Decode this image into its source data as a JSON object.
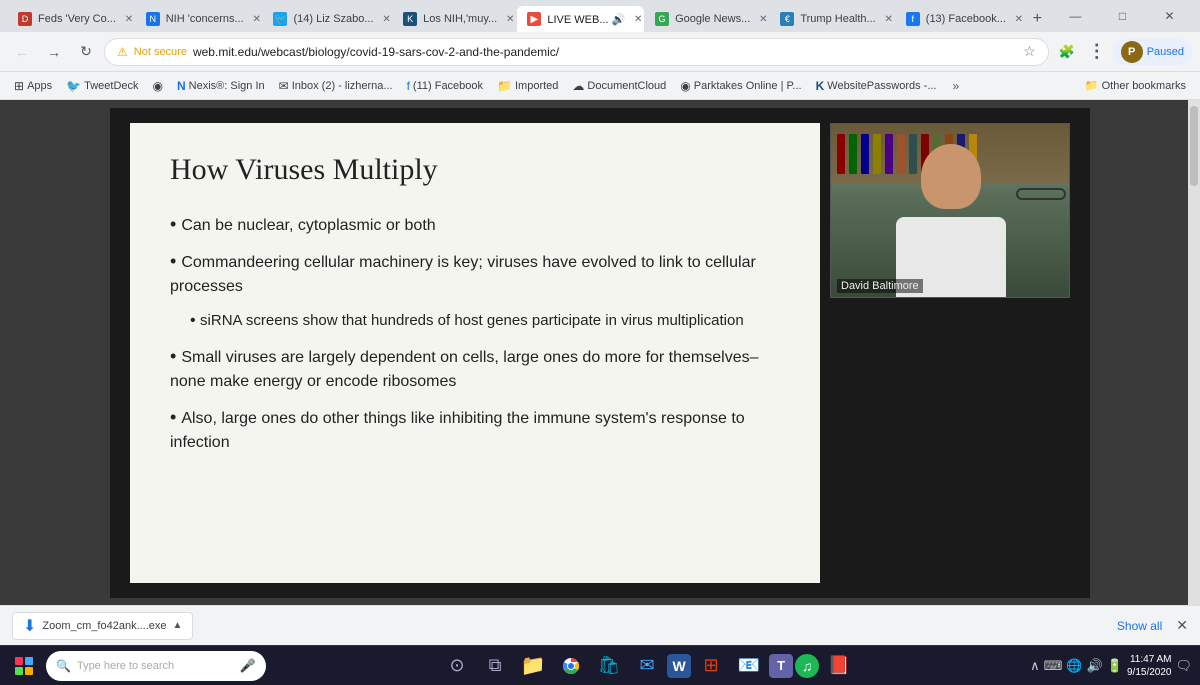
{
  "titlebar": {
    "tabs": [
      {
        "id": "tab1",
        "favicon": "DB",
        "favicon_bg": "#c0392b",
        "label": "Feds 'Very Co...",
        "active": false
      },
      {
        "id": "tab2",
        "favicon": "N",
        "favicon_bg": "#1a73e8",
        "label": "NIH 'concerns...",
        "active": false
      },
      {
        "id": "tab3",
        "favicon": "🐦",
        "favicon_bg": "#1da1f2",
        "label": "(14) Liz Szabo...",
        "active": false
      },
      {
        "id": "tab4",
        "favicon": "K",
        "favicon_bg": "#1a5276",
        "label": "Los NIH,'muy...",
        "active": false
      },
      {
        "id": "tab5",
        "favicon": "▶",
        "favicon_bg": "#e74c3c",
        "label": "LIVE WEB... 🔊",
        "active": true
      },
      {
        "id": "tab6",
        "favicon": "G",
        "favicon_bg": "#34a853",
        "label": "Google News...",
        "active": false
      },
      {
        "id": "tab7",
        "favicon": "€",
        "favicon_bg": "#2980b9",
        "label": "Trump Health...",
        "active": false
      },
      {
        "id": "tab8",
        "favicon": "f",
        "favicon_bg": "#1877f2",
        "label": "(13) Facebook...",
        "active": false
      }
    ],
    "window_controls": [
      "—",
      "□",
      "✕"
    ]
  },
  "navbar": {
    "url": "web.mit.edu/webcast/biology/covid-19-sars-cov-2-and-the-pandemic/",
    "url_display": "web.mit.edu/webcast/biology/covid-19-sars-cov-2-and-the-pandemic/",
    "profile_label": "Paused",
    "profile_initial": "P"
  },
  "bookmarks": {
    "items": [
      {
        "icon": "⊞",
        "label": "Apps"
      },
      {
        "icon": "🐦",
        "label": "TweetDeck"
      },
      {
        "icon": "◉",
        "label": ""
      },
      {
        "icon": "N",
        "label": "Nexis®: Sign In"
      },
      {
        "icon": "✉",
        "label": "Inbox (2) - lizherna..."
      },
      {
        "icon": "f",
        "label": "(11) Facebook"
      },
      {
        "icon": "📁",
        "label": "Imported"
      },
      {
        "icon": "☁",
        "label": "DocumentCloud"
      },
      {
        "icon": "◉",
        "label": "Parktakes Online | P..."
      },
      {
        "icon": "K",
        "label": "WebsitePasswords -..."
      }
    ],
    "more_label": "»",
    "other_label": "Other bookmarks"
  },
  "slide": {
    "title": "How Viruses Multiply",
    "bullets": [
      {
        "text": "Can be nuclear, cytoplasmic or both",
        "sub": false
      },
      {
        "text": "Commandeering cellular machinery is key; viruses have evolved to link to cellular processes",
        "sub": false
      },
      {
        "text": "siRNA screens show that hundreds of host genes participate in virus multiplication",
        "sub": true
      },
      {
        "text": "Small viruses are largely dependent on cells, large ones do more for themselves– none make energy or encode ribosomes",
        "sub": false
      },
      {
        "text": "Also, large ones do other things like inhibiting the immune system's response to infection",
        "sub": false
      }
    ]
  },
  "speaker": {
    "label": "David Baltimore"
  },
  "taskbar": {
    "search_placeholder": "Type here to search",
    "apps": [
      {
        "name": "cortana",
        "symbol": "⊙"
      },
      {
        "name": "task-view",
        "symbol": "⧉"
      },
      {
        "name": "file-explorer",
        "symbol": "📁"
      },
      {
        "name": "chrome",
        "symbol": "⊕"
      },
      {
        "name": "windows-store",
        "symbol": "🛍"
      },
      {
        "name": "mail",
        "symbol": "✉"
      },
      {
        "name": "word",
        "symbol": "W"
      },
      {
        "name": "office",
        "symbol": "⊞"
      },
      {
        "name": "outlook",
        "symbol": "📧"
      },
      {
        "name": "teams",
        "symbol": "T"
      },
      {
        "name": "spotify",
        "symbol": "♫"
      },
      {
        "name": "acrobat",
        "symbol": "📕"
      }
    ],
    "clock_time": "11:47 AM",
    "clock_date": "9/15/2020"
  },
  "downloads": {
    "item_name": "Zoom_cm_fo42ank....exe",
    "item_icon": "⬇",
    "show_all_label": "Show all",
    "close_label": "✕"
  }
}
